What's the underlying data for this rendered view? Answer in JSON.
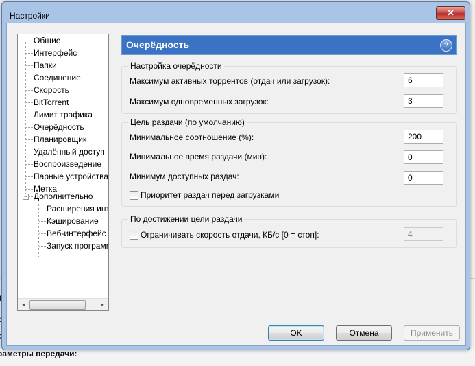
{
  "background": {
    "line_a": "Ф",
    "line_b": "р",
    "line_c": "с",
    "bold_text": "раметры передачи:"
  },
  "window": {
    "title": "Настройки",
    "close_glyph": "✕"
  },
  "tree": {
    "items": [
      {
        "label": "Общие"
      },
      {
        "label": "Интерфейс"
      },
      {
        "label": "Папки"
      },
      {
        "label": "Соединение"
      },
      {
        "label": "Скорость"
      },
      {
        "label": "BitTorrent"
      },
      {
        "label": "Лимит трафика"
      },
      {
        "label": "Очерёдность",
        "selected": true
      },
      {
        "label": "Планировщик"
      },
      {
        "label": "Удалённый доступ"
      },
      {
        "label": "Воспроизведение"
      },
      {
        "label": "Парные устройства"
      },
      {
        "label": "Метка"
      },
      {
        "label": "Дополнительно",
        "expanded": true
      }
    ],
    "children": [
      {
        "label": "Расширения интерфейса"
      },
      {
        "label": "Кэширование"
      },
      {
        "label": "Веб-интерфейс"
      },
      {
        "label": "Запуск программы"
      }
    ],
    "expander_glyph": "−",
    "scroll_left": "◄",
    "scroll_right": "►"
  },
  "panel": {
    "title": "Очерёдность",
    "help": "?"
  },
  "queue": {
    "title": "Настройка очерёдности",
    "max_active_label": "Максимум активных торрентов (отдач или загрузок):",
    "max_active_value": "6",
    "max_downloads_label": "Максимум одновременных загрузок:",
    "max_downloads_value": "3"
  },
  "seeding": {
    "title": "Цель раздачи (по умолчанию)",
    "min_ratio_label": "Минимальное соотношение (%):",
    "min_ratio_value": "200",
    "min_time_label": "Минимальное время раздачи (мин):",
    "min_time_value": "0",
    "min_seeds_label": "Минимум доступных раздач:",
    "min_seeds_value": "0",
    "priority_label": "Приоритет раздач перед загрузками",
    "priority_checked": false
  },
  "goal": {
    "title": "По достижении цели раздачи",
    "limit_label": "Ограничивать скорость отдачи, КБ/с [0 = стоп]:",
    "limit_checked": false,
    "limit_value": "4"
  },
  "buttons": {
    "ok": "OK",
    "cancel": "Отмена",
    "apply": "Применить"
  }
}
